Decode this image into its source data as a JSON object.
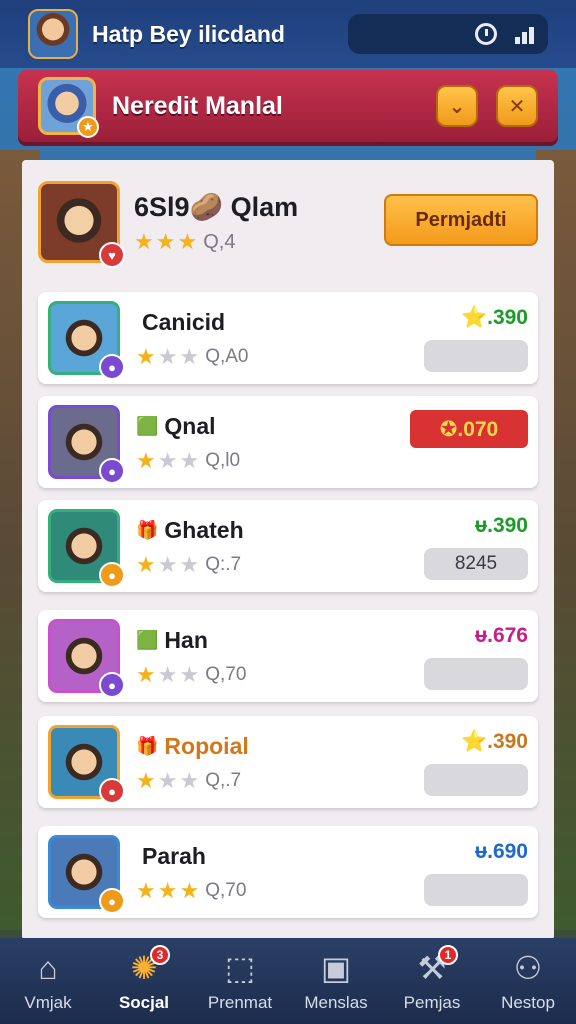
{
  "topbar": {
    "title": "Hatp Bey ilicdand",
    "icons": [
      "clock-icon",
      "signal-icon"
    ]
  },
  "header": {
    "title": "Neredit Manlal",
    "buttons": [
      "chevron-down-icon",
      "close-icon"
    ],
    "chevron_glyph": "⌄",
    "close_glyph": "✕"
  },
  "featured": {
    "name": "6Sl9🥔 Qlam",
    "stars_on": 3,
    "sub": "Q,4",
    "button_label": "Permjadti",
    "badge_color": "#d83a3a"
  },
  "players": [
    {
      "name": "Canicid",
      "tag": "",
      "stars_on": 1,
      "sub": "Q,A0",
      "score": "⭐.390",
      "score_color": "#1e9a2a",
      "pill": "",
      "border": "#36b07a",
      "avatar_bg": "#5aa6d8",
      "badge_color": "#7a4bd0",
      "score_style": "normal"
    },
    {
      "name": "Qnal",
      "tag": "🟩",
      "stars_on": 1,
      "sub": "Q,l0",
      "score": "✪.070",
      "score_color": "#ffd84a",
      "pill": "",
      "border": "#7a4bd0",
      "avatar_bg": "#6b6b8e",
      "badge_color": "#7a4bd0",
      "score_style": "red"
    },
    {
      "name": "Ghateh",
      "tag": "🎁",
      "stars_on": 1,
      "sub": "Q:.7",
      "score": "ᵾ.390",
      "score_color": "#1e9a2a",
      "pill": "8245",
      "border": "#36b07a",
      "avatar_bg": "#2f8a7a",
      "badge_color": "#f09a1a",
      "score_style": "normal"
    },
    {
      "name": "Han",
      "tag": "🟩",
      "stars_on": 1,
      "sub": "Q,70",
      "score": "ᵾ.676",
      "score_color": "#c81e8a",
      "pill": "",
      "border": "#c94fd0",
      "avatar_bg": "#b462c8",
      "badge_color": "#7a4bd0",
      "score_style": "normal"
    },
    {
      "name": "Ropoial",
      "tag": "🎁",
      "stars_on": 1,
      "sub": "Q,.7",
      "score": "⭐.390",
      "score_color": "#c8781e",
      "pill": "",
      "border": "#f0a32e",
      "avatar_bg": "#3a8ab8",
      "badge_color": "#d83a3a",
      "score_style": "normal",
      "name_color": "#d0781a"
    },
    {
      "name": "Parah",
      "tag": "",
      "stars_on": 3,
      "sub": "Q,70",
      "score": "ᵾ.690",
      "score_color": "#1e6ac8",
      "pill": "",
      "border": "#3a8ad8",
      "avatar_bg": "#4a7ab8",
      "badge_color": "#f09a1a",
      "score_style": "normal"
    }
  ],
  "bottom_nav": [
    {
      "label": "Vmjak",
      "icon": "home-icon",
      "glyph": "⌂",
      "badge": ""
    },
    {
      "label": "Socjal",
      "icon": "social-mascot-icon",
      "glyph": "✺",
      "badge": "3",
      "active": true
    },
    {
      "label": "Prenmat",
      "icon": "chat-icon",
      "glyph": "⬚",
      "badge": ""
    },
    {
      "label": "Menslas",
      "icon": "map-icon",
      "glyph": "▣",
      "badge": ""
    },
    {
      "label": "Pemjas",
      "icon": "tools-icon",
      "glyph": "⚒",
      "badge": "1"
    },
    {
      "label": "Nestop",
      "icon": "profile-icon",
      "glyph": "⚇",
      "badge": ""
    }
  ]
}
